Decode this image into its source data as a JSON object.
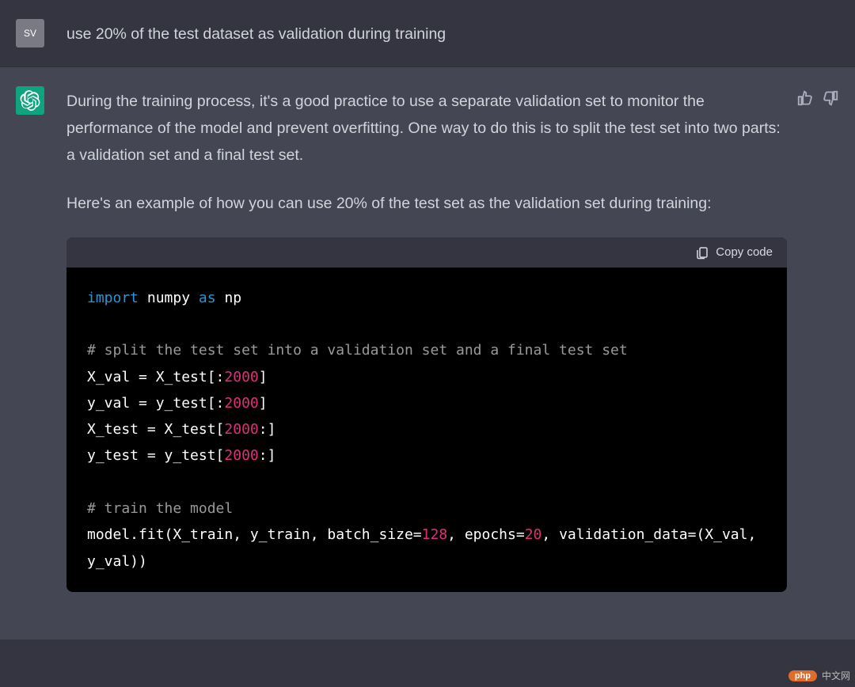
{
  "user": {
    "avatar_initials": "SV",
    "message": "use 20% of the test dataset as validation during training"
  },
  "assistant": {
    "paragraph1": "During the training process, it's a good practice to use a separate validation set to monitor the performance of the model and prevent overfitting. One way to do this is to split the test set into two parts: a validation set and a final test set.",
    "paragraph2": "Here's an example of how you can use 20% of the test set as the validation set during training:"
  },
  "code": {
    "copy_label": "Copy code",
    "kw_import": "import",
    "mod_numpy": "numpy",
    "kw_as": "as",
    "mod_np": "np",
    "comment1": "# split the test set into a validation set and a final test set",
    "l1a": "X_val = X_test[:",
    "l1n": "2000",
    "l1b": "]",
    "l2a": "y_val = y_test[:",
    "l2n": "2000",
    "l2b": "]",
    "l3a": "X_test = X_test[",
    "l3n": "2000",
    "l3b": ":]",
    "l4a": "y_test = y_test[",
    "l4n": "2000",
    "l4b": ":]",
    "comment2": "# train the model",
    "fit_a": "model.fit(X_train, y_train, batch_size=",
    "fit_n1": "128",
    "fit_b": ", epochs=",
    "fit_n2": "20",
    "fit_c": ", validation_data=(X_val, y_val))"
  },
  "watermark": {
    "pill": "php",
    "text": "中文网"
  }
}
